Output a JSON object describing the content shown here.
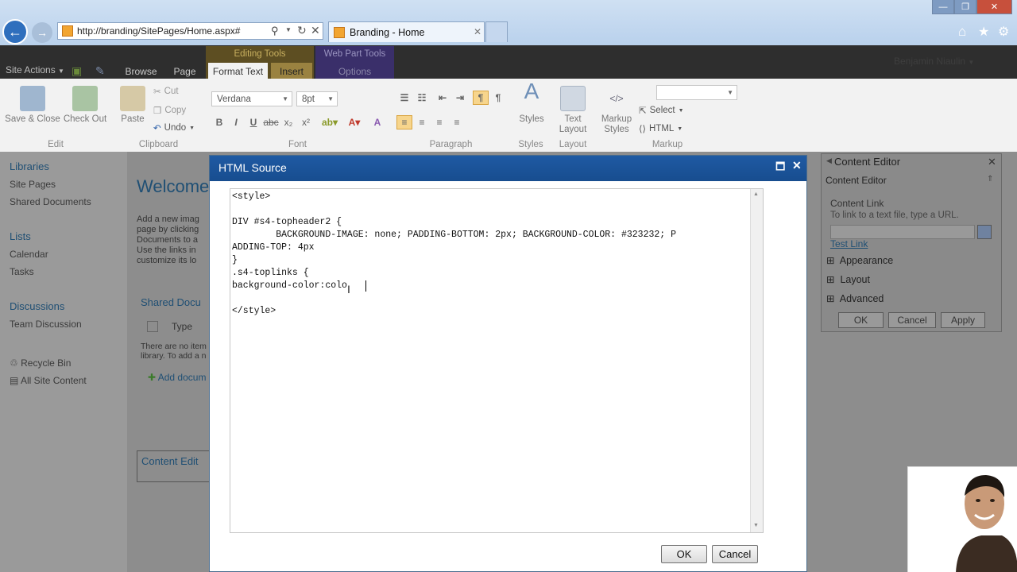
{
  "browser": {
    "address": "http://branding/SitePages/Home.aspx#",
    "tab_title": "Branding - Home"
  },
  "topbar": {
    "site_actions": "Site Actions",
    "browse": "Browse",
    "page": "Page",
    "editing_tools": "Editing Tools",
    "format_text": "Format Text",
    "insert": "Insert",
    "web_part_tools": "Web Part Tools",
    "options": "Options",
    "user": "Benjamin Niaulin"
  },
  "ribbon": {
    "save_close": "Save & Close",
    "check_out": "Check Out",
    "edit_label": "Edit",
    "paste": "Paste",
    "cut": "Cut",
    "copy": "Copy",
    "undo": "Undo",
    "clipboard_label": "Clipboard",
    "font_name": "Verdana",
    "font_size": "8pt",
    "font_label": "Font",
    "paragraph_label": "Paragraph",
    "styles": "Styles",
    "styles_label": "Styles",
    "text_layout": "Text Layout",
    "layout_label": "Layout",
    "markup_styles": "Markup Styles",
    "select": "Select",
    "html": "HTML",
    "markup_label": "Markup"
  },
  "leftnav": {
    "libraries": "Libraries",
    "site_pages": "Site Pages",
    "shared_documents": "Shared Documents",
    "lists": "Lists",
    "calendar": "Calendar",
    "tasks": "Tasks",
    "discussions": "Discussions",
    "team_discussion": "Team Discussion",
    "recycle_bin": "Recycle Bin",
    "all_site_content": "All Site Content"
  },
  "main": {
    "welcome": "Welcome",
    "intro": "Add a new imag\npage by clicking\nDocuments to a\nUse the links in\ncustomize its lo",
    "shared_docs": "Shared Docu",
    "type_col": "Type",
    "empty": "There are no item\nlibrary. To add a n",
    "add_doc": "Add docum",
    "content_editor": "Content Edit"
  },
  "webpart_panel": {
    "title": "Content Editor",
    "subtitle": "Content Editor",
    "content_link": "Content Link",
    "hint": "To link to a text file, type a URL.",
    "test_link": "Test Link",
    "appearance": "Appearance",
    "layout": "Layout",
    "advanced": "Advanced",
    "ok": "OK",
    "cancel": "Cancel",
    "apply": "Apply"
  },
  "dialog": {
    "title": "HTML Source",
    "code": "<style>\n\nDIV #s4-topheader2 {\n        BACKGROUND-IMAGE: none; PADDING-BOTTOM: 2px; BACKGROUND-COLOR: #323232; P\nADDING-TOP: 4px\n}\n.s4-toplinks {\nbackground-color:colo\n\n</style>",
    "ok": "OK",
    "cancel": "Cancel"
  }
}
